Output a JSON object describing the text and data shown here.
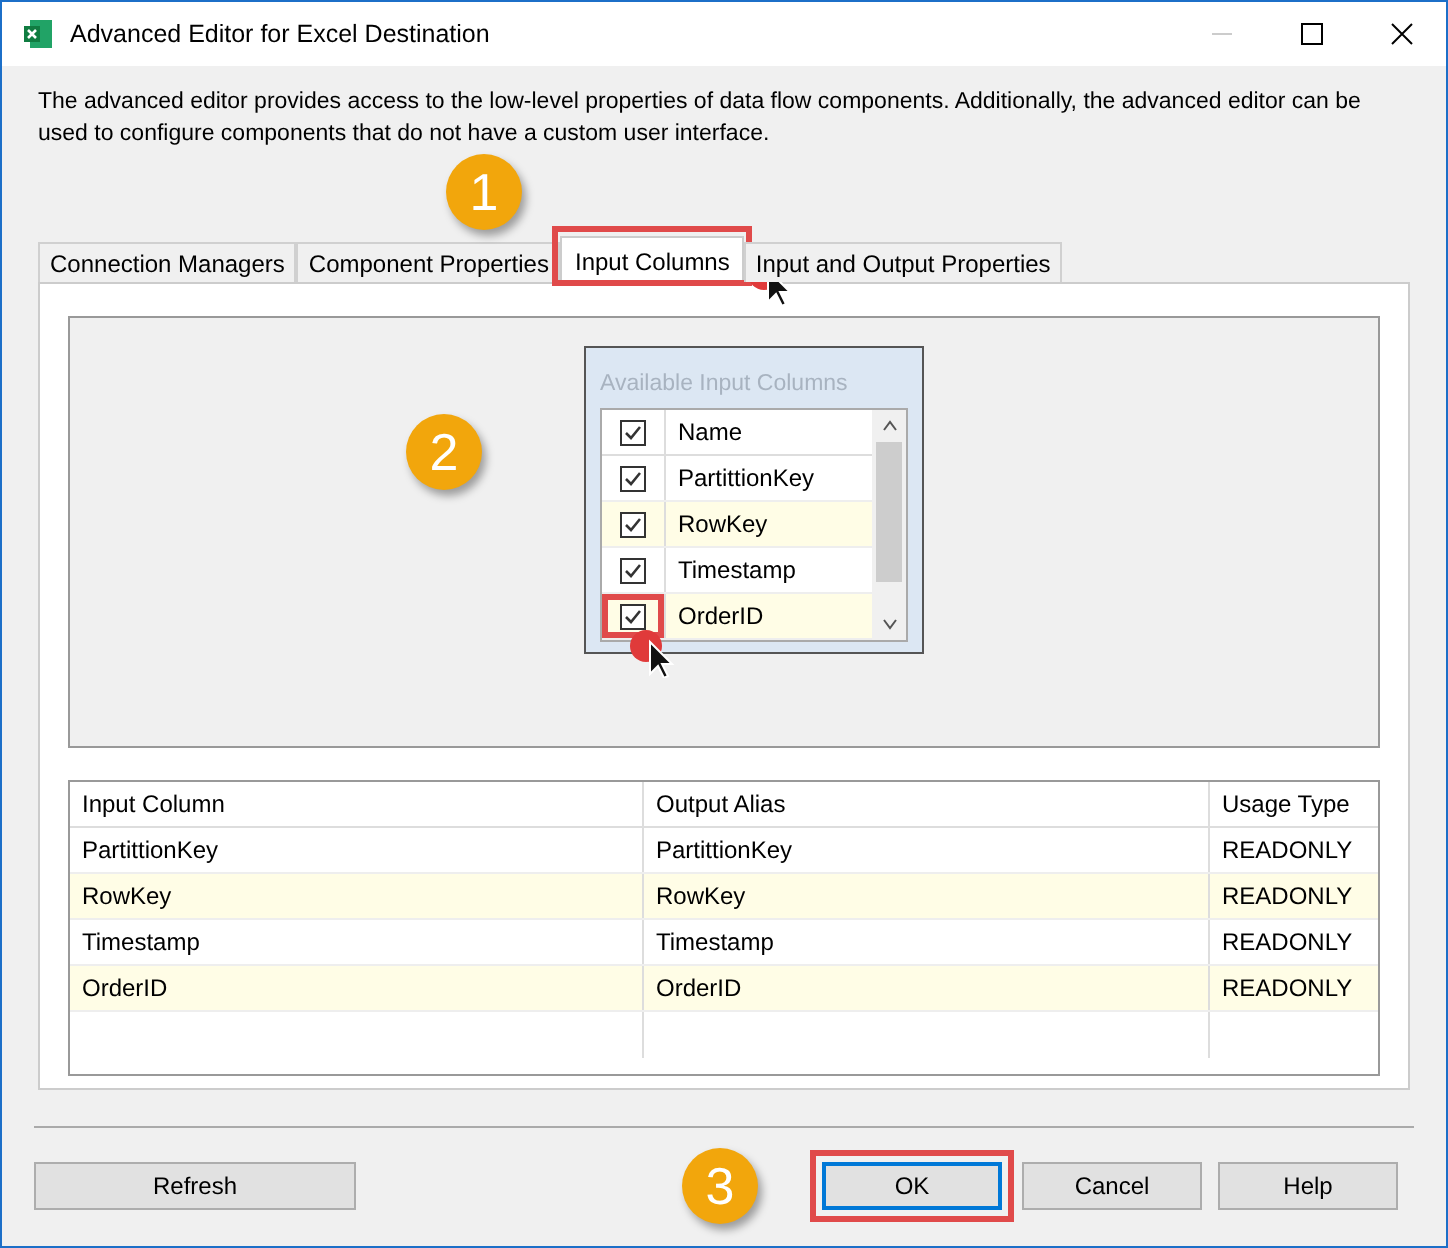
{
  "window": {
    "title": "Advanced Editor for Excel Destination"
  },
  "description": "The advanced editor provides access to the low-level properties of data flow components. Additionally, the advanced editor can be used to configure components that do not have a custom user interface.",
  "tabs": [
    {
      "label": "Connection Managers",
      "selected": false,
      "highlighted": false
    },
    {
      "label": "Component Properties",
      "selected": false,
      "highlighted": false
    },
    {
      "label": "Input Columns",
      "selected": true,
      "highlighted": true
    },
    {
      "label": "Input and Output Properties",
      "selected": false,
      "highlighted": false
    }
  ],
  "available_columns": {
    "title": "Available Input Columns",
    "header": {
      "label": "Name",
      "checked": true
    },
    "rows": [
      {
        "name": "PartittionKey",
        "checked": true,
        "highlighted": false
      },
      {
        "name": "RowKey",
        "checked": true,
        "highlighted": false
      },
      {
        "name": "Timestamp",
        "checked": true,
        "highlighted": false
      },
      {
        "name": "OrderID",
        "checked": true,
        "highlighted": true
      }
    ]
  },
  "mapping_table": {
    "columns": [
      "Input Column",
      "Output Alias",
      "Usage Type"
    ],
    "rows": [
      [
        "PartittionKey",
        "PartittionKey",
        "READONLY"
      ],
      [
        "RowKey",
        "RowKey",
        "READONLY"
      ],
      [
        "Timestamp",
        "Timestamp",
        "READONLY"
      ],
      [
        "OrderID",
        "OrderID",
        "READONLY"
      ]
    ]
  },
  "buttons": [
    {
      "label": "Refresh",
      "highlighted": false
    },
    {
      "label": "OK",
      "highlighted": true
    },
    {
      "label": "Cancel",
      "highlighted": false
    },
    {
      "label": "Help",
      "highlighted": false
    }
  ],
  "steps": [
    "1",
    "2",
    "3"
  ]
}
